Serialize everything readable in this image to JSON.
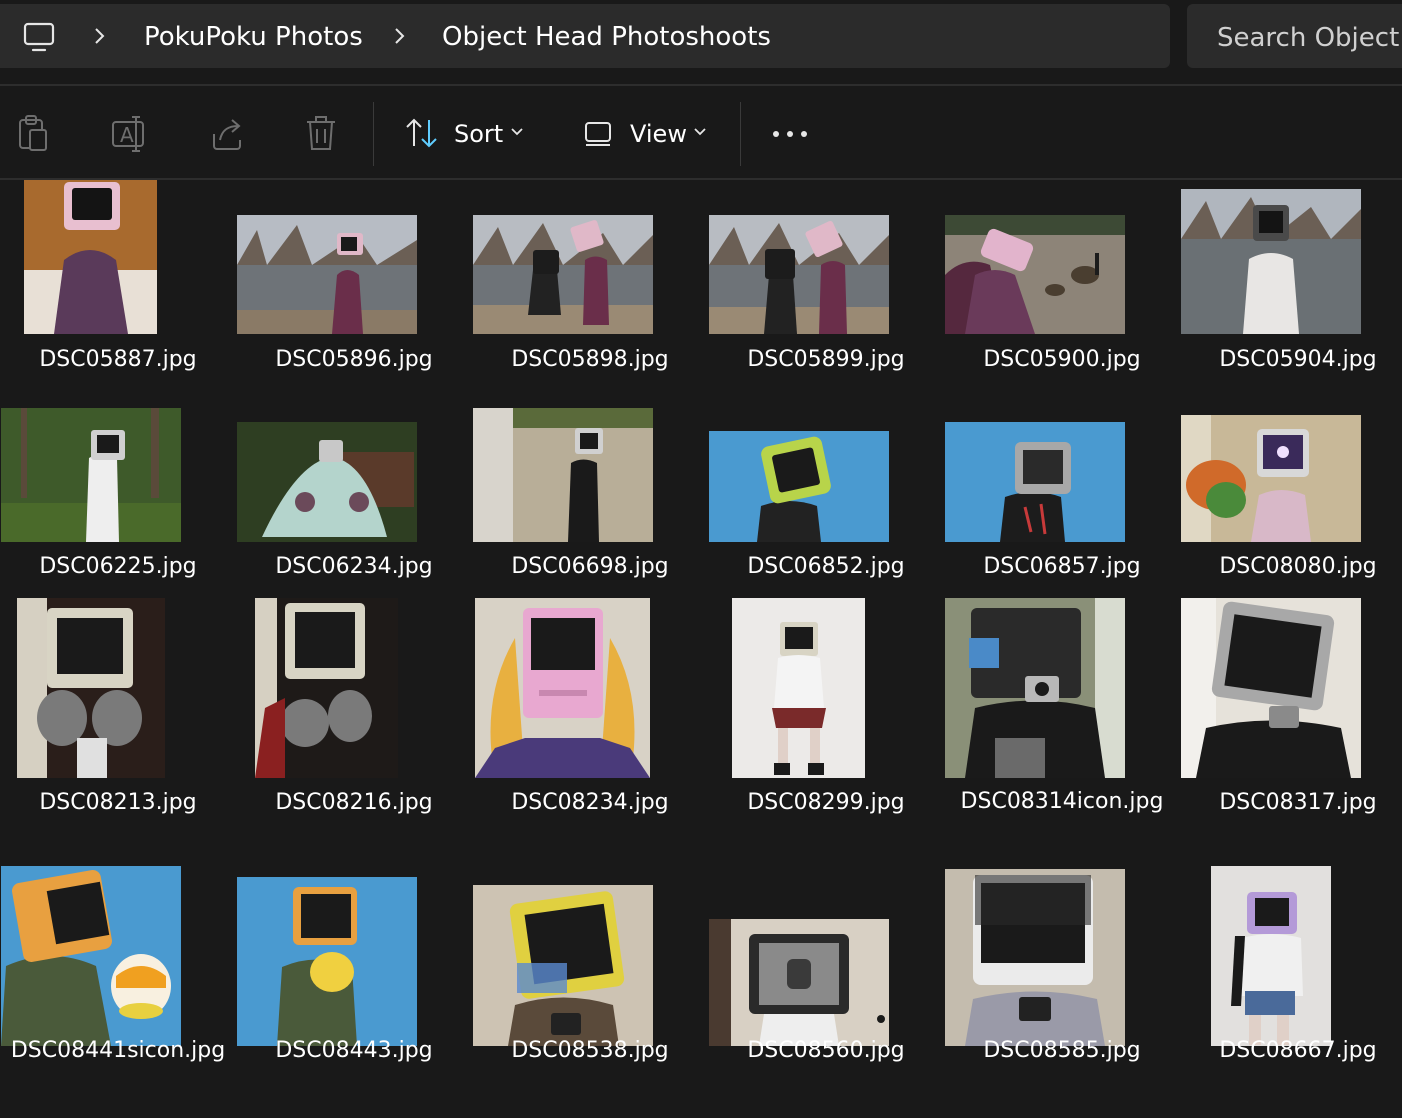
{
  "address_bar": {
    "breadcrumbs": [
      {
        "label": "PokuPoku Photos"
      },
      {
        "label": "Object Head Photoshoots"
      }
    ],
    "icons": {
      "root": "monitor-icon",
      "separator": "chevron-right-icon"
    }
  },
  "search": {
    "placeholder": "Search Object Head Photoshoots"
  },
  "toolbar": {
    "sort_label": "Sort",
    "view_label": "View",
    "icons": [
      "clipboard-icon",
      "rename-icon",
      "share-icon",
      "delete-icon",
      "sort-icon",
      "view-icon",
      "more-icon"
    ]
  },
  "files": [
    {
      "name": "DSC05887.jpg"
    },
    {
      "name": "DSC05896.jpg"
    },
    {
      "name": "DSC05898.jpg"
    },
    {
      "name": "DSC05899.jpg"
    },
    {
      "name": "DSC05900.jpg"
    },
    {
      "name": "DSC05904.jpg"
    },
    {
      "name": "DSC06225.jpg"
    },
    {
      "name": "DSC06234.jpg"
    },
    {
      "name": "DSC06698.jpg"
    },
    {
      "name": "DSC06852.jpg"
    },
    {
      "name": "DSC06857.jpg"
    },
    {
      "name": "DSC08080.jpg"
    },
    {
      "name": "DSC08213.jpg"
    },
    {
      "name": "DSC08216.jpg"
    },
    {
      "name": "DSC08234.jpg"
    },
    {
      "name": "DSC08299.jpg"
    },
    {
      "name": "DSC08314icon.jpg"
    },
    {
      "name": "DSC08317.jpg"
    },
    {
      "name": "DSC08441sicon.jpg"
    },
    {
      "name": "DSC08443.jpg"
    },
    {
      "name": "DSC08538.jpg"
    },
    {
      "name": "DSC08560.jpg"
    },
    {
      "name": "DSC08585.jpg"
    },
    {
      "name": "DSC08667.jpg"
    }
  ],
  "colors": {
    "background": "#191919",
    "bar": "#2b2b2b",
    "text": "#ffffff",
    "accent": "#60cdff"
  }
}
